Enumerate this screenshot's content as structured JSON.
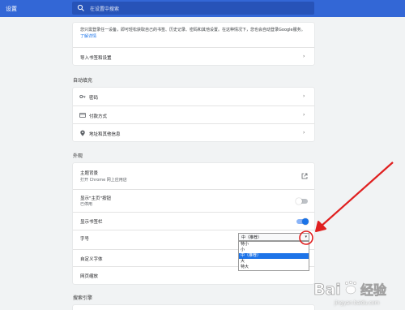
{
  "header": {
    "title": "设置",
    "search_placeholder": "在设置中搜索"
  },
  "account": {
    "description": "您只需登录任一设备，即可轻松获取自己的书签、历史记录、密码和其他设置。在这种情况下，您也会自动登录Google服务。",
    "learn_more": "了解详情",
    "import_label": "导入书签和设置"
  },
  "autofill": {
    "section_title": "自动填充",
    "items": [
      {
        "label": "密码",
        "icon": "key-icon"
      },
      {
        "label": "付款方式",
        "icon": "credit-card-icon"
      },
      {
        "label": "地址和其他信息",
        "icon": "location-pin-icon"
      }
    ]
  },
  "appearance": {
    "section_title": "外观",
    "theme_title": "主题背景",
    "theme_sub": "打开 Chrome 网上应用店",
    "home_title": "显示\"主页\"按钮",
    "home_sub": "已停用",
    "home_toggle": "off",
    "bookmarks_bar": "显示书签栏",
    "bookmarks_toggle": "on",
    "font_size_label": "字号",
    "font_size_selected": "中（推荐）",
    "font_size_options": [
      "特小",
      "小",
      "中（推荐）",
      "大",
      "特大"
    ],
    "custom_fonts": "自定义字体",
    "page_zoom": "网页缩放"
  },
  "search_engine": {
    "section_title": "搜索引擎"
  },
  "colors": {
    "header": "#3367d6",
    "accent": "#1a73e8",
    "annotation": "#e02020"
  },
  "watermark": {
    "brand": "Bai经验",
    "site": "jingyan.baidu.com"
  }
}
